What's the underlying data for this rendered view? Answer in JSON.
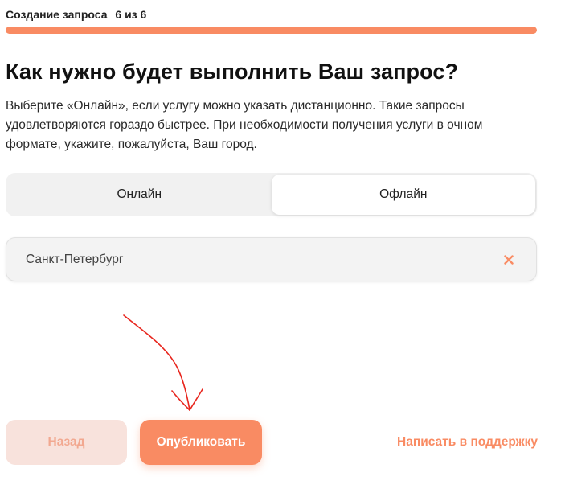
{
  "header": {
    "step_label": "Создание запроса",
    "step_count": "6 из 6",
    "progress": 1.0
  },
  "main": {
    "title": "Как нужно будет выполнить Ваш запрос?",
    "description": "Выберите «Онлайн», если услугу можно указать дистанционно. Такие запросы удовлетворяются гораздо быстрее. При необходимости получения услуги в очном формате, укажите, пожалуйста, Ваш город."
  },
  "mode_toggle": {
    "options": [
      {
        "label": "Онлайн",
        "selected": false
      },
      {
        "label": "Офлайн",
        "selected": true
      }
    ]
  },
  "city_field": {
    "value": "Санкт-Петербург",
    "clear_icon": "close-x-icon"
  },
  "footer": {
    "back_label": "Назад",
    "publish_label": "Опубликовать",
    "support_label": "Написать в поддержку"
  },
  "colors": {
    "accent": "#f98b63",
    "accent_light": "#f8e2dc",
    "annotation": "#e8251d"
  }
}
